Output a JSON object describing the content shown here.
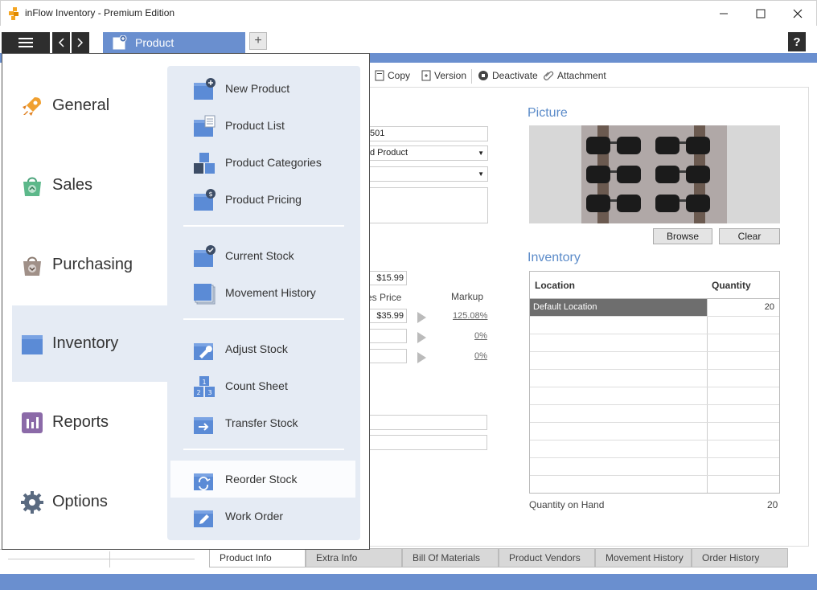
{
  "window": {
    "title": "inFlow Inventory - Premium Edition"
  },
  "tabs": {
    "active_tab": "Product",
    "add_symbol": "+",
    "help_symbol": "?"
  },
  "toolbar": {
    "copy": "Copy",
    "version": "Version",
    "deactivate": "Deactivate",
    "attachment": "Attachment"
  },
  "product_form": {
    "item_number_partial": "501",
    "type_partial": "d Product",
    "cost": "$15.99",
    "sales_price_label_partial": "es Price",
    "markup_label": "Markup",
    "sales_price": "$35.99",
    "markup_1": "125.08%",
    "markup_2": "0%",
    "markup_3": "0%"
  },
  "picture": {
    "heading": "Picture",
    "browse": "Browse",
    "clear": "Clear"
  },
  "inventory": {
    "heading": "Inventory",
    "col_location": "Location",
    "col_quantity": "Quantity",
    "rows": [
      {
        "location": "Default Location",
        "quantity": "20"
      }
    ],
    "qoh_label": "Quantity on Hand",
    "qoh_value": "20"
  },
  "bottom_tabs": [
    "Product Info",
    "Extra Info",
    "Bill Of Materials",
    "Product Vendors",
    "Movement History",
    "Order History"
  ],
  "menu": {
    "categories": [
      "General",
      "Sales",
      "Purchasing",
      "Inventory",
      "Reports",
      "Options"
    ],
    "active_category": "Inventory",
    "submenu": {
      "new_product": "New Product",
      "product_list": "Product List",
      "product_categories": "Product Categories",
      "product_pricing": "Product Pricing",
      "current_stock": "Current Stock",
      "movement_history": "Movement History",
      "adjust_stock": "Adjust Stock",
      "count_sheet": "Count Sheet",
      "transfer_stock": "Transfer Stock",
      "reorder_stock": "Reorder Stock",
      "work_order": "Work Order"
    }
  },
  "colors": {
    "accent": "#6a8fcf",
    "menu_bg": "#e5ebf4",
    "heading_blue": "#5b8bc9"
  }
}
